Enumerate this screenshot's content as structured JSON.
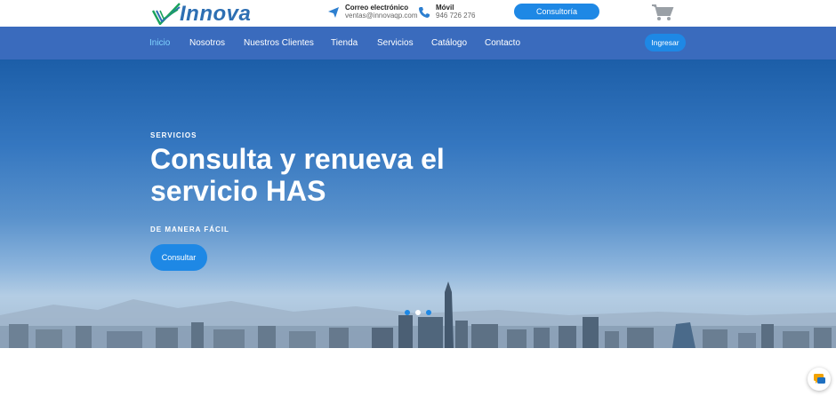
{
  "header": {
    "logo_text": "Innova",
    "email": {
      "label": "Correo electrónico",
      "value": "ventas@innovaqp.com"
    },
    "mobile": {
      "label": "Móvil",
      "value": "946 726 276"
    },
    "consultoria_label": "Consultoría"
  },
  "nav": {
    "items": [
      {
        "label": "Inicio",
        "active": true
      },
      {
        "label": "Nosotros"
      },
      {
        "label": "Nuestros Clientes"
      },
      {
        "label": "Tienda"
      },
      {
        "label": "Servicios"
      },
      {
        "label": "Catálogo"
      },
      {
        "label": "Contacto"
      }
    ],
    "login_label": "Ingresar"
  },
  "hero": {
    "eyebrow": "SERVICIOS",
    "headline": "Consulta y renueva el servicio HAS",
    "subline": "DE MANERA FÁCIL",
    "cta_label": "Consultar",
    "slides": 3,
    "active_slide": 2
  },
  "colors": {
    "primary": "#1e88e5",
    "nav_bg": "#3a6bbd",
    "active_link": "#7fd3ff",
    "logo": "#2d6fb3"
  }
}
